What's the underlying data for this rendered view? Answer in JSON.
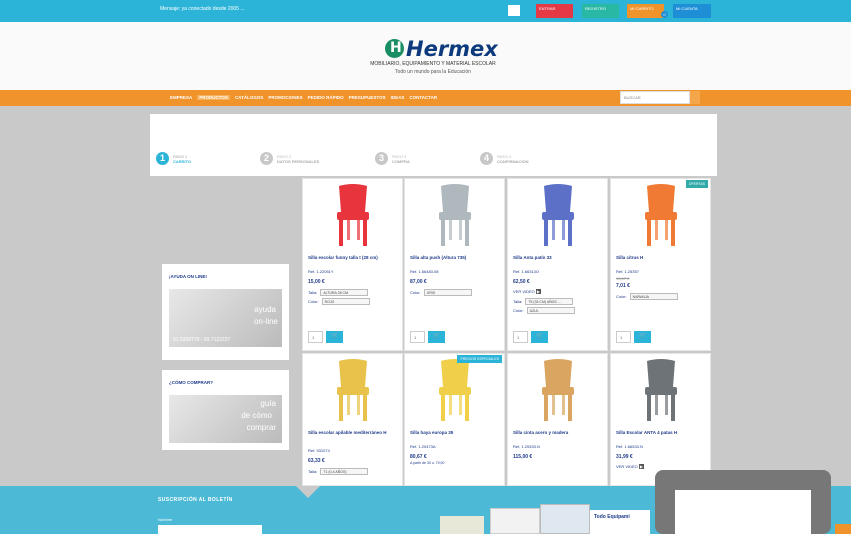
{
  "topbar": {
    "welcome": "Mensaje: ya conectado desde 2005 ...",
    "buttons": [
      {
        "label": "ENTRAR",
        "color": "#e53945"
      },
      {
        "label": "REGISTRO",
        "color": "#28b8a4"
      },
      {
        "label": "MI CARRITO",
        "color": "#f0932b"
      },
      {
        "label": "MI CUENTA",
        "color": "#1e8fd6"
      }
    ],
    "cart_count": "0"
  },
  "header": {
    "logo": "Hermex",
    "logo_symbol": "H",
    "subtitle": "MOBILIARIO, EQUIPAMIENTO Y MATERIAL ESCOLAR",
    "tagline": "Todo un mundo para la Educación"
  },
  "nav": {
    "items": [
      "EMPRESA",
      "PRODUCTOS",
      "CATÁLOGOS",
      "PROMOCIONES",
      "PEDIDO RÁPIDO",
      "PRESUPUESTOS",
      "IDEAS",
      "CONTACTAR"
    ],
    "active_index": 1,
    "search_placeholder": "BUSCAR"
  },
  "steps": [
    {
      "number": "1",
      "pre": "PASO 1",
      "label": "CARRITO",
      "active": true
    },
    {
      "number": "2",
      "pre": "PASO 2",
      "label": "DATOS PERSONALES",
      "active": false
    },
    {
      "number": "3",
      "pre": "PASO 3",
      "label": "COMPRA",
      "active": false
    },
    {
      "number": "4",
      "pre": "PASO 4",
      "label": "CONFIRMACIÓN",
      "active": false
    }
  ],
  "sidebar": {
    "help_title": "¡AYUDA ON LINE!",
    "help_text_1": "ayuda",
    "help_text_2": "on-line",
    "help_phone": "91 5308779 - 93 7122227",
    "buy_title": "¿CÓMO COMPRAR?",
    "buy_text_1": "guía",
    "buy_text_2": "de cómo",
    "buy_text_3": "comprar"
  },
  "products": [
    {
      "name": "Silla escolar funny talla t (28 cm)",
      "ref": "Ref. 1.22051Y",
      "price": "15,00 €",
      "opt1_label": "Talla:",
      "opt1_value": "ALTURA 28 CM",
      "opt2_label": "Color:",
      "opt2_value": "ROJO",
      "qty": "1",
      "chair_color": "#e8343c"
    },
    {
      "name": "Silla alta push (Altura 735)",
      "ref": "Ref. 1.66483.08",
      "price": "87,00 €",
      "opt1_label": "Color:",
      "opt1_value": "GRIS",
      "qty": "1",
      "chair_color": "#aeb8bd"
    },
    {
      "name": "Silla Anta patín 33",
      "ref": "Ref. 1.66313O",
      "price": "62,50 €",
      "video": "VER VIDEO",
      "opt1_label": "Talla:",
      "opt1_value": "T5 (33 CM) AÑOS ...",
      "opt2_label": "Color:",
      "opt2_value": "AZUL",
      "qty": "1",
      "chair_color": "#5d70c8"
    },
    {
      "name": "Silla citrus H",
      "ref": "Ref. 1.25357",
      "old_price": "15,57 €",
      "price": "7,01 €",
      "opt1_label": "Color:",
      "opt1_value": "NARANJA",
      "qty": "1",
      "badge": "OFERTAS",
      "chair_color": "#f07a34"
    },
    {
      "name": "Silla escolar apilable mediterráneo H",
      "ref": "Ref. 931074",
      "price": "63,33 €",
      "opt1_label": "Talla:",
      "opt1_value": "T1 (0-4 AÑOS)",
      "chair_color": "#e8c24a"
    },
    {
      "name": "Silla haya europa 35",
      "ref": "Ref. 1.20473A",
      "price": "80,67 €",
      "note": "A partir de 30 u. 79,90",
      "badge": "PRECIOS ESPECIALES",
      "chair_color": "#f0d04a"
    },
    {
      "name": "Silla cinta acero y madera",
      "ref": "Ref. 1.20533.N",
      "price": "115,00 €",
      "chair_color": "#d9a561"
    },
    {
      "name": "Silla Escolar ANTA 4 patas H",
      "ref": "Ref. 1.66533.N",
      "price": "31,99 €",
      "video": "VER VIDEO",
      "chair_color": "#6e7378"
    }
  ],
  "footer": {
    "title": "SUSCRIPCIÓN AL BOLETÍN",
    "field_label": "Nombre"
  },
  "banner_text": "Todo Equipami"
}
